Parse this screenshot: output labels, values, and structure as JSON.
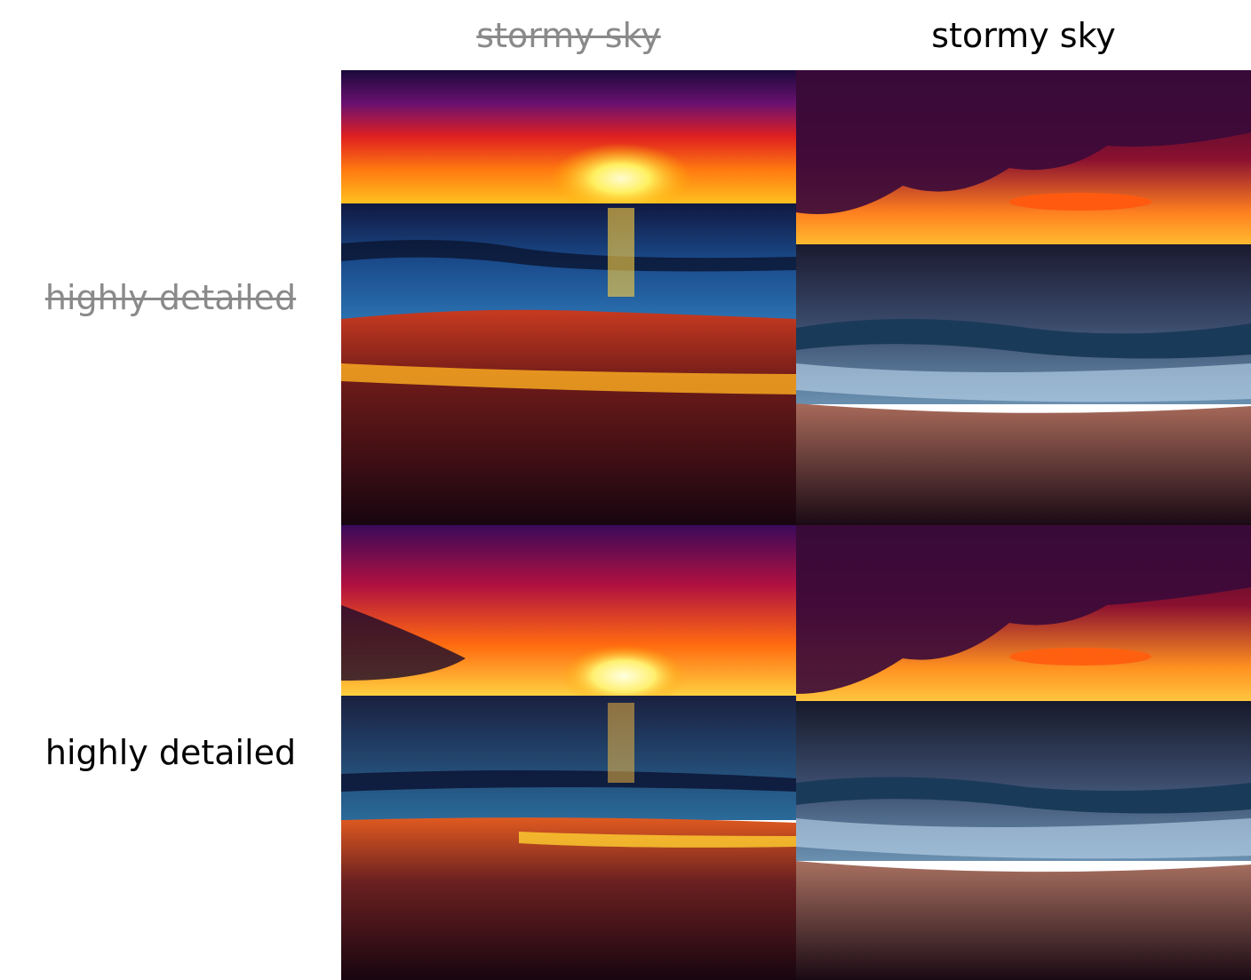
{
  "columns": [
    {
      "label": "stormy sky",
      "negated": true
    },
    {
      "label": "stormy sky",
      "negated": false
    }
  ],
  "rows": [
    {
      "label": "highly detailed",
      "negated": true
    },
    {
      "label": "highly detailed",
      "negated": false
    }
  ],
  "cells": [
    {
      "content": "sunset-beach-photo"
    },
    {
      "content": "stormy-sunset-beach-photo"
    },
    {
      "content": "detailed-sunset-beach-photo"
    },
    {
      "content": "detailed-stormy-sunset-beach-photo"
    }
  ]
}
